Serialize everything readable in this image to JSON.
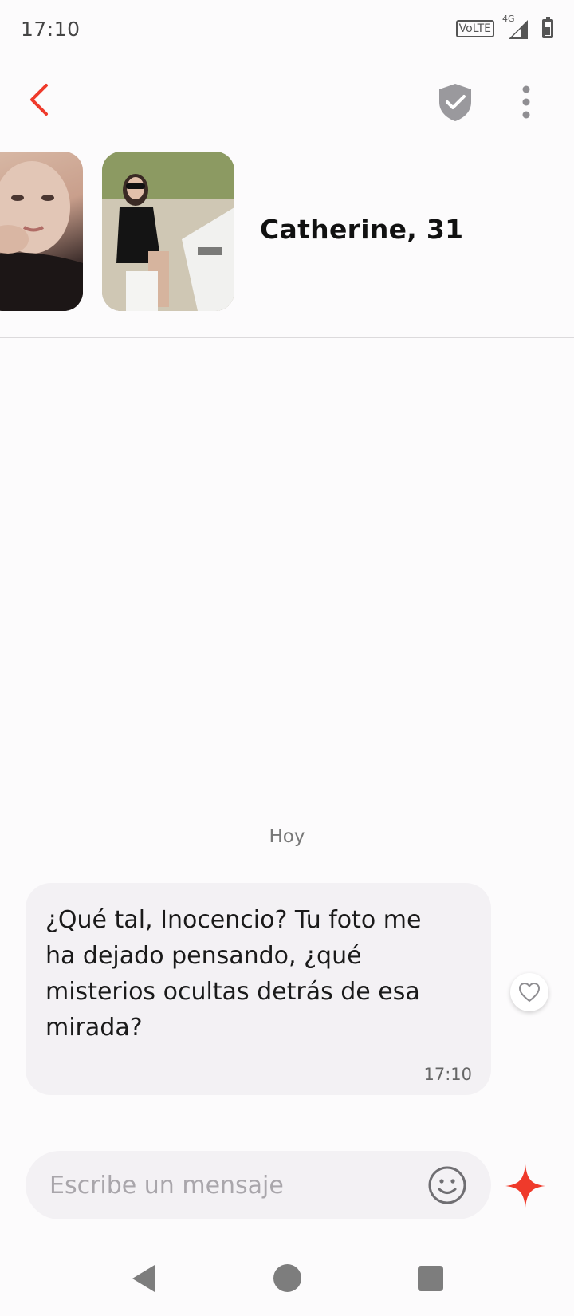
{
  "status_bar": {
    "time": "17:10",
    "volte": "VoLTE",
    "network": "4G",
    "icons": [
      "volte-icon",
      "signal-icon",
      "battery-icon"
    ]
  },
  "header": {
    "icons": [
      "back-arrow-icon",
      "shield-check-icon",
      "more-vertical-icon"
    ]
  },
  "profile": {
    "name_age": "Catherine, 31",
    "photos": [
      "photo-selfie",
      "photo-park-bench"
    ]
  },
  "chat": {
    "day_label": "Hoy",
    "messages": [
      {
        "text": "¿Qué tal, Inocencio? Tu foto me ha dejado pensando, ¿qué misterios ocultas detrás de esa mirada?",
        "time": "17:10"
      }
    ]
  },
  "composer": {
    "placeholder": "Escribe un mensaje",
    "value": "",
    "icons": [
      "emoji-icon",
      "sparkle-icon"
    ]
  },
  "nav_bar": {
    "icons": [
      "nav-back-icon",
      "nav-home-icon",
      "nav-recents-icon"
    ]
  },
  "colors": {
    "accent": "#ef3a2b",
    "background": "#fcfbfc",
    "bubble": "#f3f1f4",
    "shield": "#9a999d"
  }
}
